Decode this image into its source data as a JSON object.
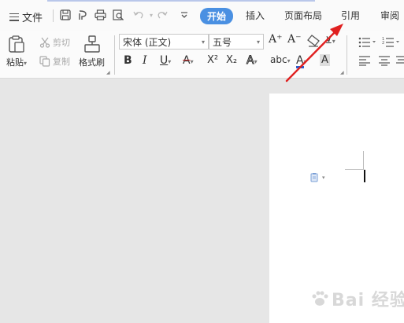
{
  "menu": {
    "file_label": "文件"
  },
  "tabs": [
    {
      "label": "开始",
      "active": true
    },
    {
      "label": "插入"
    },
    {
      "label": "页面布局"
    },
    {
      "label": "引用"
    },
    {
      "label": "审阅"
    }
  ],
  "clipboard": {
    "paste_label": "粘贴",
    "cut_label": "剪切",
    "copy_label": "复制",
    "format_painter_label": "格式刷"
  },
  "font": {
    "family_value": "宋体 (正文)",
    "size_value": "五号",
    "grow_label": "A⁺",
    "shrink_label": "A⁻",
    "bold_label": "B",
    "italic_label": "I",
    "underline_label": "U",
    "strike_label": "A",
    "superscript_label": "X²",
    "subscript_label": "X₂",
    "effects_label": "A",
    "pinyin_label": "abc",
    "color_label": "A",
    "shade_label": "A"
  },
  "colors": {
    "accent": "#4a90e2",
    "annotation_arrow": "#e02020",
    "font_color_underline": "#2a5ecf",
    "strike_color": "#d03030"
  },
  "watermark": {
    "text": "Bai 经验"
  }
}
